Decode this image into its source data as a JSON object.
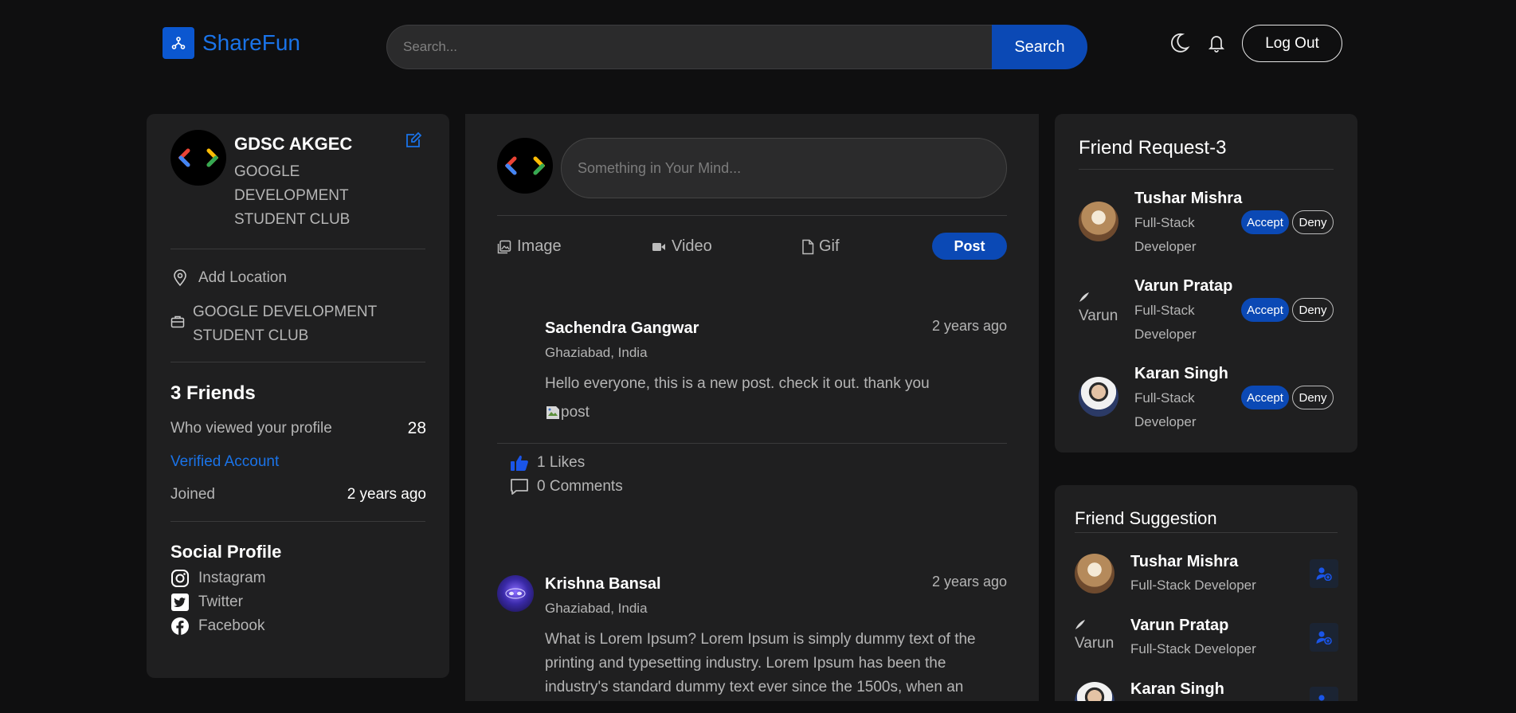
{
  "header": {
    "brand": "ShareFun",
    "search_placeholder": "Search...",
    "search_button": "Search",
    "logout_button": "Log Out"
  },
  "profile": {
    "name": "GDSC AKGEC",
    "subtitle_lines": [
      "GOOGLE",
      "DEVELOPMENT",
      "STUDENT CLUB"
    ],
    "location_label": "Add Location",
    "org_lines": [
      "GOOGLE DEVELOPMENT",
      "STUDENT CLUB"
    ],
    "friends": "3 Friends",
    "viewed_label": "Who viewed your profile",
    "viewed_count": "28",
    "verified": "Verified Account",
    "joined_label": "Joined",
    "joined_value": "2 years ago",
    "social_title": "Social Profile",
    "socials": [
      "Instagram",
      "Twitter",
      "Facebook"
    ]
  },
  "composer": {
    "placeholder": "Something in Your Mind...",
    "image_label": "Image",
    "video_label": "Video",
    "gif_label": "Gif",
    "post_button": "Post"
  },
  "posts": [
    {
      "author": "Sachendra Gangwar",
      "location": "Ghaziabad, India",
      "time": "2 years ago",
      "text": "Hello everyone, this is a new post. check it out. thank you",
      "image_alt": "post",
      "likes": "1 Likes",
      "comments": "0 Comments"
    },
    {
      "author": "Krishna Bansal",
      "location": "Ghaziabad, India",
      "time": "2 years ago",
      "text_lines": [
        "What is Lorem Ipsum? Lorem Ipsum is simply dummy text of the",
        "printing and typesetting industry. Lorem Ipsum has been the",
        "industry's standard dummy text ever since the 1500s, when an"
      ]
    }
  ],
  "friend_requests": {
    "title": "Friend Request-3",
    "accept_label": "Accept",
    "deny_label": "Deny",
    "items": [
      {
        "name": "Tushar Mishra",
        "role_lines": [
          "Full-Stack",
          "Developer"
        ]
      },
      {
        "name": "Varun Pratap",
        "role_lines": [
          "Full-Stack",
          "Developer"
        ],
        "avatar_alt": "Varun"
      },
      {
        "name": "Karan Singh",
        "role_lines": [
          "Full-Stack",
          "Developer"
        ]
      }
    ]
  },
  "friend_suggestions": {
    "title": "Friend Suggestion",
    "items": [
      {
        "name": "Tushar Mishra",
        "role": "Full-Stack Developer"
      },
      {
        "name": "Varun Pratap",
        "role": "Full-Stack Developer",
        "avatar_alt": "Varun"
      },
      {
        "name": "Karan Singh",
        "role": ""
      }
    ]
  },
  "colors": {
    "background": "#0f0f10",
    "card": "#1f1f20",
    "accent": "#0b49b5",
    "link": "#1a73e8"
  }
}
